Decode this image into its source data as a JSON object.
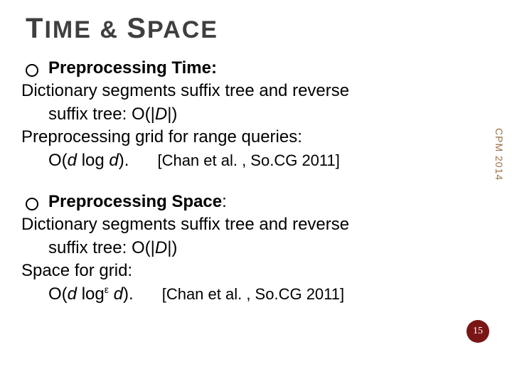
{
  "title": {
    "t_big": "T",
    "ime": "IME",
    "amp": " & ",
    "s_big": "S",
    "pace": "PACE"
  },
  "section1": {
    "heading": "Preprocessing Time:",
    "line1": "Dictionary segments suffix tree and reverse",
    "line2_pre": "suffix tree: O(|",
    "line2_D": "D",
    "line2_post": "|)",
    "line3": "Preprocessing grid for range queries:",
    "line4_pre": "O(",
    "line4_d1": "d",
    "line4_mid": " log ",
    "line4_d2": "d",
    "line4_post": ").",
    "cite": "[Chan et al. , So.CG 2011]"
  },
  "section2": {
    "heading_pre": "Preprocessing Space",
    "heading_post": ":",
    "line1": "Dictionary segments suffix tree and reverse",
    "line2_pre": "suffix tree: O(|",
    "line2_D": "D",
    "line2_post": "|)",
    "line3": "Space for grid:",
    "line4_pre": "O(",
    "line4_d1": "d",
    "line4_mid": " log",
    "line4_eps": "ε",
    "line4_sp": " ",
    "line4_d2": "d",
    "line4_post": ").",
    "cite": "[Chan et al. , So.CG 2011]"
  },
  "side_label": "CPM 2014",
  "page_number": "15"
}
